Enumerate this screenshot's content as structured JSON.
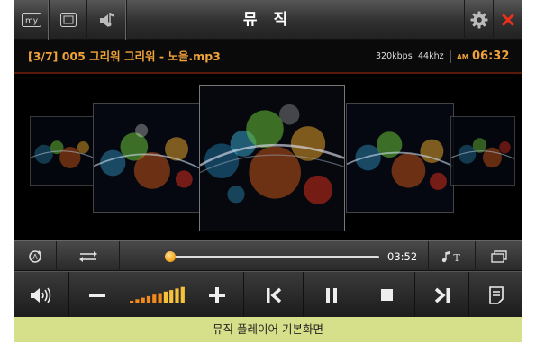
{
  "header": {
    "title": "뮤 직",
    "my_label": "my"
  },
  "track": {
    "name": "[3/7] 005 그리워 그리워 - 노을.mp3",
    "bitrate": "320kbps",
    "samplerate": "44khz",
    "ampm": "AM",
    "time": "06:32"
  },
  "playback": {
    "duration": "03:52",
    "progress_fraction": 0.0
  },
  "volume": {
    "level_bars": 10,
    "max_bars": 10
  },
  "caption": "뮤직 플레이어 기본화면",
  "icons": {
    "my": "my-icon",
    "window": "window-icon",
    "music": "music-note-icon",
    "settings": "gear-icon",
    "close": "close-icon",
    "repeat": "repeat-icon",
    "shuffle": "shuffle-icon",
    "lyrics": "lyrics-icon",
    "playlist": "playlist-icon",
    "volume": "speaker-icon",
    "minus": "minus-icon",
    "plus": "plus-icon",
    "prev": "previous-icon",
    "pause": "pause-icon",
    "stop": "stop-icon",
    "next": "next-icon",
    "list": "list-icon"
  },
  "colors": {
    "accent": "#f0a23a",
    "close": "#e8301c",
    "caption_bg": "#d6e08a"
  }
}
